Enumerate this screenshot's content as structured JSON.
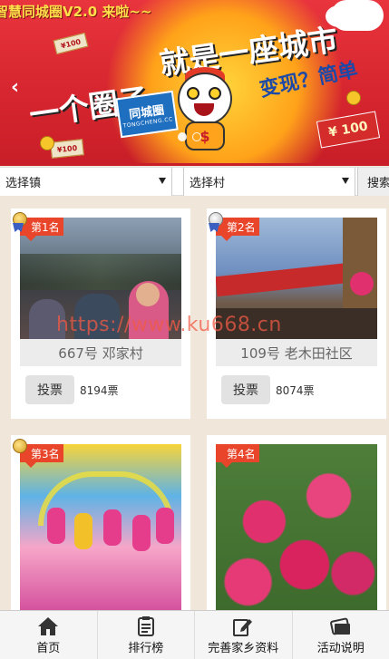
{
  "banner": {
    "ticker": "智慧同城圈V2.0 来啦~~",
    "slogan_line1": "一个圈子",
    "slogan_line2": "就是一座城市",
    "logo_cn": "同城圈",
    "logo_en": "TONGCHENG.CC",
    "cash_text": "变现？简单",
    "money_small": "¥100",
    "money_large": "¥ 100",
    "prev_arrow": "‹"
  },
  "filters": {
    "town_select": "选择镇",
    "village_select": "选择村",
    "search_label": "搜索"
  },
  "entries": [
    {
      "rank": "第1名",
      "name": "667号 邓家村",
      "votes": "8194票",
      "vote_button": "投票"
    },
    {
      "rank": "第2名",
      "name": "109号 老木田社区",
      "votes": "8074票",
      "vote_button": "投票"
    },
    {
      "rank": "第3名"
    },
    {
      "rank": "第4名"
    }
  ],
  "watermark": "https://www.ku668.cn",
  "nav": [
    {
      "label": "首页",
      "icon": "home-icon"
    },
    {
      "label": "排行榜",
      "icon": "ranking-list-icon"
    },
    {
      "label": "完善家乡资料",
      "icon": "edit-icon"
    },
    {
      "label": "活动说明",
      "icon": "info-card-icon"
    }
  ],
  "colors": {
    "banner_red": "#d7262f",
    "rank_tag": "#e8452a",
    "page_bg": "#f1e6da"
  }
}
